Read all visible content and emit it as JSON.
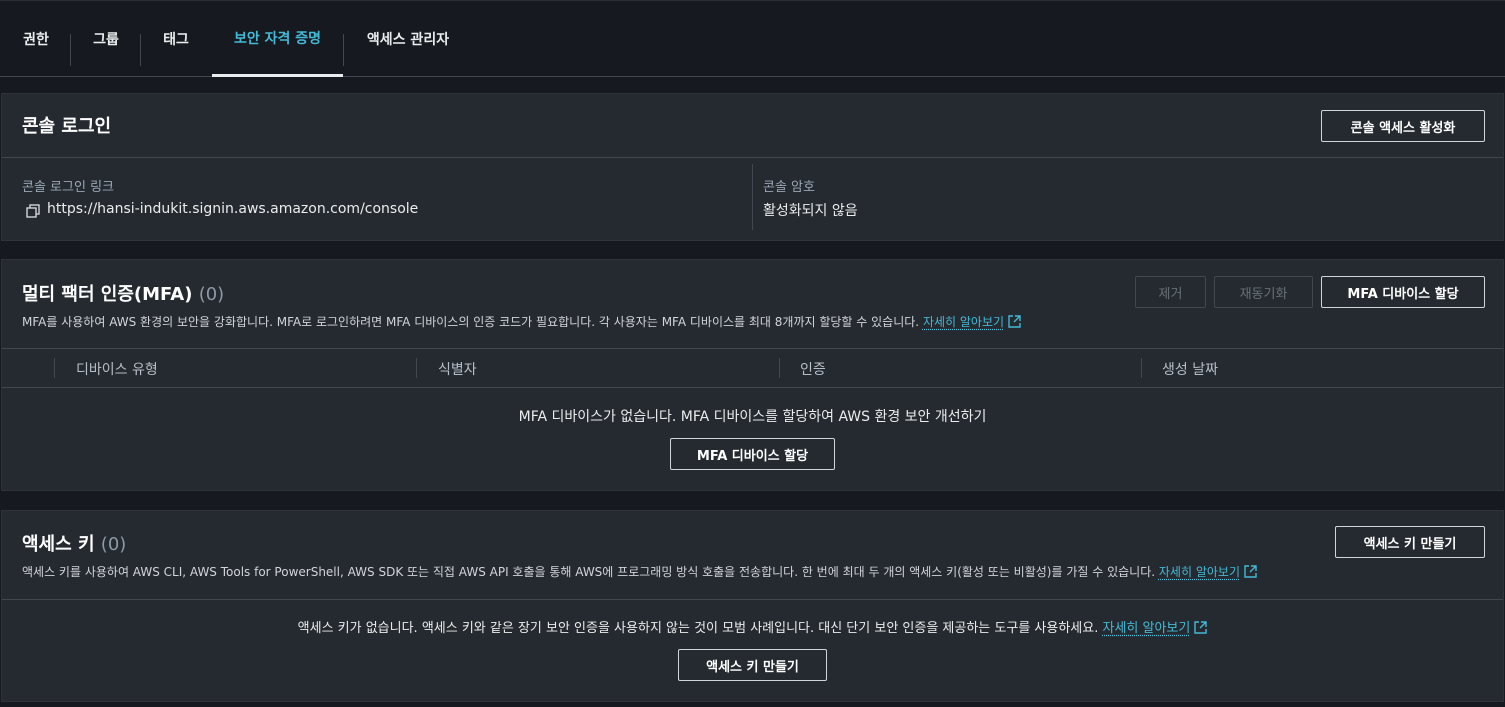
{
  "tabs": [
    {
      "label": "권한"
    },
    {
      "label": "그룹"
    },
    {
      "label": "태그"
    },
    {
      "label": "보안 자격 증명",
      "active": true
    },
    {
      "label": "액세스 관리자"
    }
  ],
  "console_login": {
    "title": "콘솔 로그인",
    "enable_button": "콘솔 액세스 활성화",
    "link_label": "콘솔 로그인 링크",
    "link_value": "https://hansi-indukit.signin.aws.amazon.com/console",
    "password_label": "콘솔 암호",
    "password_value": "활성화되지 않음"
  },
  "mfa": {
    "title": "멀티 팩터 인증(MFA)",
    "count": "(0)",
    "remove_button": "제거",
    "resync_button": "재동기화",
    "assign_button": "MFA 디바이스 할당",
    "description": "MFA를 사용하여 AWS 환경의 보안을 강화합니다. MFA로 로그인하려면 MFA 디바이스의 인증 코드가 필요합니다. 각 사용자는 MFA 디바이스를 최대 8개까지 할당할 수 있습니다.",
    "learn_more": "자세히 알아보기",
    "columns": [
      "디바이스 유형",
      "식별자",
      "인증",
      "생성 날짜"
    ],
    "empty_message": "MFA 디바이스가 없습니다. MFA 디바이스를 할당하여 AWS 환경 보안 개선하기",
    "empty_button": "MFA 디바이스 할당"
  },
  "access_keys": {
    "title": "액세스 키",
    "count": "(0)",
    "create_button": "액세스 키 만들기",
    "description": "액세스 키를 사용하여 AWS CLI, AWS Tools for PowerShell, AWS SDK 또는 직접 AWS API 호출을 통해 AWS에 프로그래밍 방식 호출을 전송합니다. 한 번에 최대 두 개의 액세스 키(활성 또는 비활성)를 가질 수 있습니다.",
    "learn_more": "자세히 알아보기",
    "empty_message": "액세스 키가 없습니다. 액세스 키와 같은 장기 보안 인증을 사용하지 않는 것이 모범 사례입니다. 대신 단기 보안 인증을 제공하는 도구를 사용하세요.",
    "empty_learn_more": "자세히 알아보기",
    "empty_button": "액세스 키 만들기"
  },
  "colors": {
    "background": "#16191f",
    "panel": "#252a30",
    "link": "#44b9d6",
    "active_tab": "#44b9d6"
  }
}
